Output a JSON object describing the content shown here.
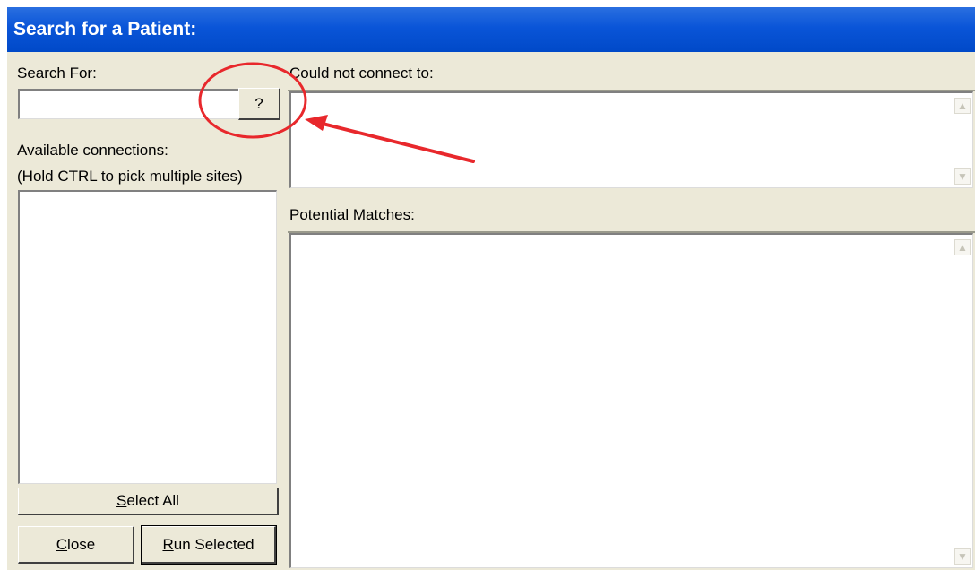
{
  "window": {
    "title": "Search for a Patient:"
  },
  "search": {
    "label": "Search For:",
    "value": "",
    "help_button_label": "?"
  },
  "connections": {
    "label_line1": "Available connections:",
    "label_line2": "(Hold CTRL to pick multiple sites)",
    "items": []
  },
  "right": {
    "could_not_connect_label": "Could not connect to:",
    "potential_matches_label": "Potential Matches:"
  },
  "buttons": {
    "select_all": {
      "mnemonic": "S",
      "rest": "elect All"
    },
    "close": {
      "mnemonic": "C",
      "rest": "lose"
    },
    "run_selected": {
      "mnemonic": "R",
      "rest": "un Selected"
    }
  },
  "icons": {
    "scroll_up": "scroll-up-arrow-icon",
    "scroll_down": "scroll-down-arrow-icon"
  },
  "colors": {
    "titlebar": "#0a55d8",
    "window_bg": "#ece9d8",
    "annotation": "#e8282c"
  }
}
